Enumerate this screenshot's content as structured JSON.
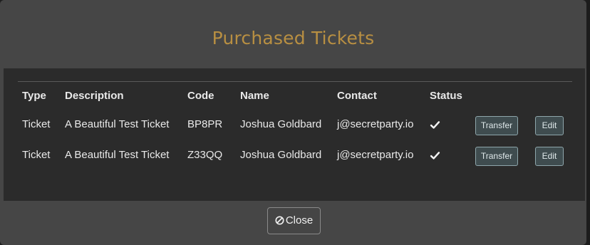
{
  "modal": {
    "title": "Purchased Tickets",
    "close_label": "Close"
  },
  "table": {
    "headers": [
      "Type",
      "Description",
      "Code",
      "Name",
      "Contact",
      "Status"
    ],
    "rows": [
      {
        "type": "Ticket",
        "description": "A Beautiful Test Ticket",
        "code": "BP8PR",
        "name": "Joshua Goldbard",
        "contact": "j@secretparty.io",
        "status_icon": "check-icon",
        "transfer_label": "Transfer",
        "edit_label": "Edit"
      },
      {
        "type": "Ticket",
        "description": "A Beautiful Test Ticket",
        "code": "Z33QQ",
        "name": "Joshua Goldbard",
        "contact": "j@secretparty.io",
        "status_icon": "check-icon",
        "transfer_label": "Transfer",
        "edit_label": "Edit"
      }
    ]
  },
  "colors": {
    "title": "#b88f42",
    "modal_bg": "#464646",
    "body_bg": "#2b2b2b",
    "button_border": "#8ea6ab"
  }
}
